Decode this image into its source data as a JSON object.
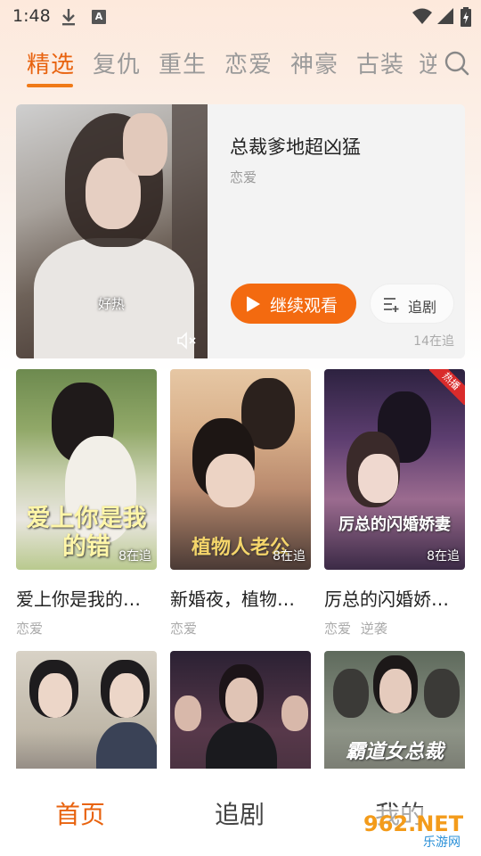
{
  "status_bar": {
    "time": "1:48",
    "a_icon": "A"
  },
  "tabs": [
    "精选",
    "复仇",
    "重生",
    "恋爱",
    "神豪",
    "古装",
    "逆"
  ],
  "featured": {
    "title": "总裁爹地超凶猛",
    "genre": "恋爱",
    "subtitle_text": "好热",
    "continue_label": "继续观看",
    "follow_label": "追剧",
    "follow_count": "14在追"
  },
  "cards": [
    {
      "title": "爱上你是我的…",
      "tags": [
        "恋爱"
      ],
      "count": "8在追",
      "poster_text": "爱上你是我的错"
    },
    {
      "title": "新婚夜，植物…",
      "tags": [
        "恋爱"
      ],
      "count": "8在追",
      "poster_text": "植物人老公"
    },
    {
      "title": "厉总的闪婚娇…",
      "tags": [
        "恋爱",
        "逆袭"
      ],
      "count": "8在追",
      "poster_text": "厉总的闪婚娇妻",
      "badge": "热播"
    },
    {
      "title": "",
      "tags": [],
      "count": ""
    },
    {
      "title": "",
      "tags": [],
      "count": ""
    },
    {
      "title": "",
      "tags": [],
      "count": "",
      "poster_text": "霸道女总裁"
    }
  ],
  "bottom_nav": [
    "首页",
    "追剧",
    "我的"
  ],
  "watermark": {
    "main": "962.NET",
    "sub": "乐游网"
  },
  "colors": {
    "accent": "#f36a10",
    "tab_active": "#e8630f",
    "tab_inactive": "#9a9a9a"
  }
}
